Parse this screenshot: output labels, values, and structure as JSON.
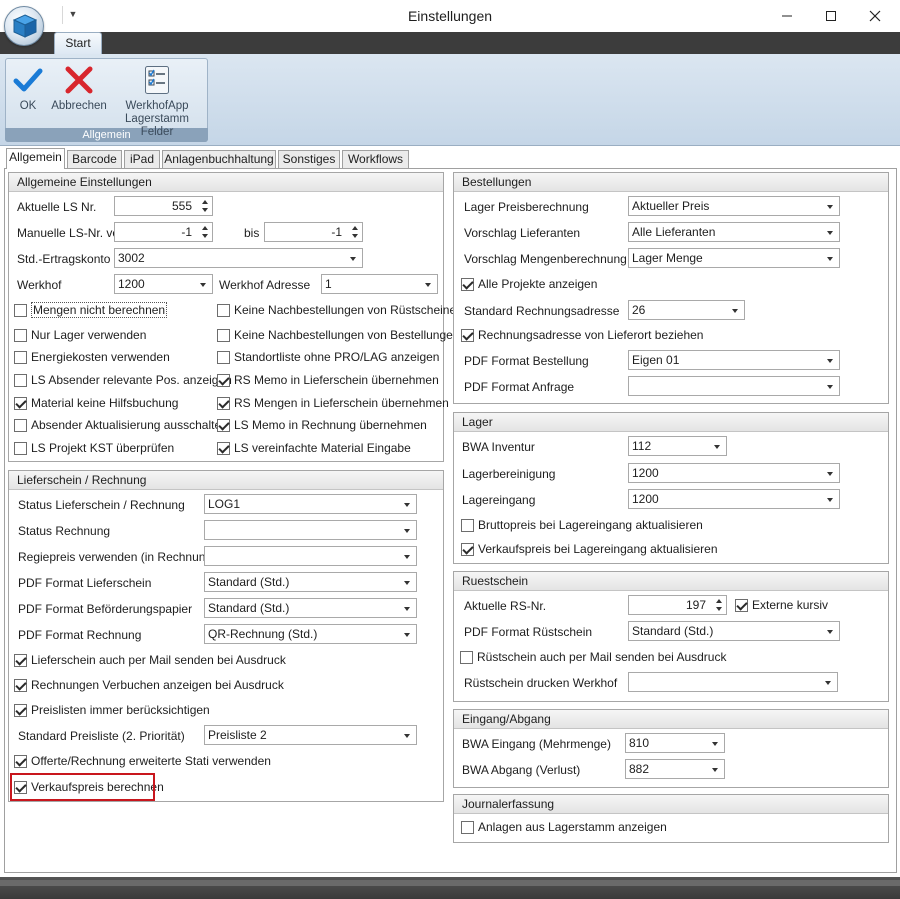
{
  "window": {
    "title": "Einstellungen"
  },
  "ribbon": {
    "tab": "Start",
    "group_label": "Allgemein",
    "ok_label": "OK",
    "cancel_label": "Abbrechen",
    "werkhof_label_1": "WerkhofApp",
    "werkhof_label_2": "Lagerstamm Felder"
  },
  "tabs": [
    "Allgemein",
    "Barcode",
    "iPad",
    "Anlagenbuchhaltung",
    "Sonstiges",
    "Workflows"
  ],
  "general": {
    "title": "Allgemeine Einstellungen",
    "ls_nr_label": "Aktuelle LS Nr.",
    "ls_nr_value": "555",
    "manual_from_label": "Manuelle LS-Nr. von",
    "manual_from_value": "-1",
    "to_label": "bis",
    "to_value": "-1",
    "account_label": "Std.-Ertragskonto",
    "account_value": "3002",
    "werkhof_label": "Werkhof",
    "werkhof_value": "1200",
    "werkhof_addr_label": "Werkhof Adresse",
    "werkhof_addr_value": "1",
    "checks_left": [
      {
        "label": "Mengen nicht berechnen",
        "checked": false
      },
      {
        "label": "Nur Lager verwenden",
        "checked": false
      },
      {
        "label": "Energiekosten verwenden",
        "checked": false
      },
      {
        "label": "LS Absender relevante Pos. anzeigen",
        "checked": false
      },
      {
        "label": "Material keine Hilfsbuchung",
        "checked": true
      },
      {
        "label": "Absender Aktualisierung ausschalten",
        "checked": false
      },
      {
        "label": "LS Projekt KST überprüfen",
        "checked": false
      }
    ],
    "checks_right": [
      {
        "label": "Keine Nachbestellungen von Rüstscheinen",
        "checked": false
      },
      {
        "label": "Keine Nachbestellungen von Bestellungen",
        "checked": false
      },
      {
        "label": "Standortliste ohne PRO/LAG anzeigen",
        "checked": false
      },
      {
        "label": "RS Memo in Lieferschein übernehmen",
        "checked": true
      },
      {
        "label": "RS Mengen in Lieferschein übernehmen",
        "checked": true
      },
      {
        "label": "LS Memo in Rechnung übernehmen",
        "checked": true
      },
      {
        "label": "LS vereinfachte Material Eingabe",
        "checked": true
      }
    ]
  },
  "delivery": {
    "title": "Lieferschein / Rechnung",
    "rows": [
      {
        "label": "Status Lieferschein / Rechnung",
        "value": "LOG1"
      },
      {
        "label": "Status Rechnung",
        "value": ""
      },
      {
        "label": "Regiepreis verwenden (in Rechnung)",
        "value": ""
      },
      {
        "label": "PDF Format Lieferschein",
        "value": "Standard (Std.)"
      },
      {
        "label": "PDF Format Beförderungspapier",
        "value": "Standard (Std.)"
      },
      {
        "label": "PDF Format Rechnung",
        "value": "QR-Rechnung (Std.)"
      }
    ],
    "check_mail": {
      "label": "Lieferschein auch per Mail senden bei Ausdruck",
      "checked": true
    },
    "check_book": {
      "label": "Rechnungen Verbuchen anzeigen bei Ausdruck",
      "checked": true
    },
    "check_price": {
      "label": "Preislisten immer berücksichtigen",
      "checked": true
    },
    "pricelist_label": "Standard Preisliste (2. Priorität)",
    "pricelist_value": "Preisliste 2",
    "check_offer": {
      "label": "Offerte/Rechnung erweiterte Stati verwenden",
      "checked": true
    },
    "check_sale": {
      "label": "Verkaufspreis berechnen",
      "checked": true
    }
  },
  "orders": {
    "title": "Bestellungen",
    "price_calc_label": "Lager Preisberechnung",
    "price_calc_value": "Aktueller Preis",
    "supplier_label": "Vorschlag Lieferanten",
    "supplier_value": "Alle Lieferanten",
    "qty_label": "Vorschlag Mengenberechnung",
    "qty_value": "Lager Menge",
    "all_projects": {
      "label": "Alle Projekte anzeigen",
      "checked": true
    },
    "billing_addr_label": "Standard Rechnungsadresse",
    "billing_addr_value": "26",
    "billing_from_supplier": {
      "label": "Rechnungsadresse von Lieferort beziehen",
      "checked": true
    },
    "pdf_order_label": "PDF Format Bestellung",
    "pdf_order_value": "Eigen 01",
    "pdf_request_label": "PDF Format Anfrage",
    "pdf_request_value": ""
  },
  "stock": {
    "title": "Lager",
    "bwa_label": "BWA Inventur",
    "bwa_value": "112",
    "clean_label": "Lagerbereinigung",
    "clean_value": "1200",
    "in_label": "Lagereingang",
    "in_value": "1200",
    "gross": {
      "label": "Bruttopreis bei Lagereingang aktualisieren",
      "checked": false
    },
    "sale": {
      "label": "Verkaufspreis bei Lagereingang aktualisieren",
      "checked": true
    }
  },
  "rs": {
    "title": "Ruestschein",
    "nr_label": "Aktuelle RS-Nr.",
    "nr_value": "197",
    "external": {
      "label": "Externe kursiv",
      "checked": true
    },
    "pdf_label": "PDF Format Rüstschein",
    "pdf_value": "Standard (Std.)",
    "mail": {
      "label": "Rüstschein auch per Mail senden bei Ausdruck",
      "checked": false
    },
    "print_label": "Rüstschein drucken Werkhof",
    "print_value": ""
  },
  "inout": {
    "title": "Eingang/Abgang",
    "in_label": "BWA Eingang (Mehrmenge)",
    "in_value": "810",
    "out_label": "BWA Abgang (Verlust)",
    "out_value": "882"
  },
  "journal": {
    "title": "Journalerfassung",
    "assets": {
      "label": "Anlagen aus Lagerstamm anzeigen",
      "checked": false
    }
  },
  "colors": {
    "accent": "#1a7bd6",
    "cancel": "#d8262d",
    "highlight": "#c8161d"
  }
}
